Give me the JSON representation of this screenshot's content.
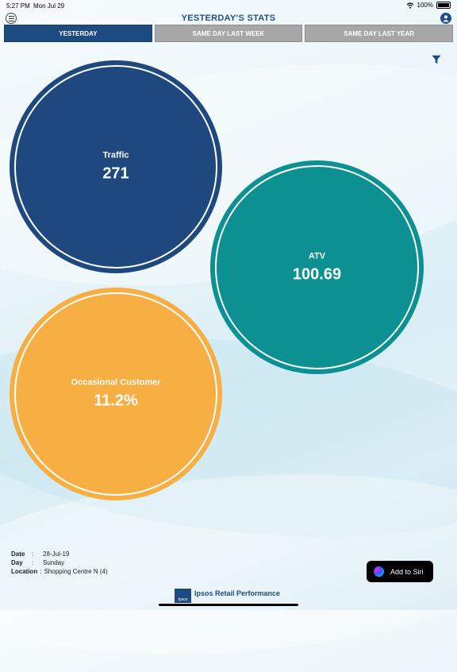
{
  "status_bar": {
    "time": "5:27 PM",
    "date": "Mon Jul 29",
    "battery": "100%"
  },
  "header": {
    "title": "YESTERDAY'S STATS"
  },
  "tabs": [
    {
      "label": "YESTERDAY",
      "active": true
    },
    {
      "label": "SAME DAY LAST WEEK",
      "active": false
    },
    {
      "label": "SAME DAY LAST YEAR",
      "active": false
    }
  ],
  "metrics": [
    {
      "label": "Traffic",
      "value": "271",
      "color": "#1f497e"
    },
    {
      "label": "ATV",
      "value": "100.69",
      "color": "#0d9091"
    },
    {
      "label": "Occasional Customer",
      "value": "11.2%",
      "color": "#f7ae42"
    }
  ],
  "info": {
    "date_key": "Date",
    "date_value": "28-Jul-19",
    "day_key": "Day",
    "day_value": "Sunday",
    "location_key": "Location",
    "location_value": "Shopping Centre N (4)",
    "separator": ":"
  },
  "siri": {
    "label": "Add to Siri"
  },
  "footer": {
    "logo_text": "Ipsos",
    "brand": "Ipsos Retail Performance"
  },
  "colors": {
    "accent": "#1e4a82",
    "tab_inactive": "#a7a7a7"
  },
  "icons": [
    "menu-icon",
    "user-icon",
    "filter-icon",
    "wifi-icon",
    "battery-icon",
    "siri-icon"
  ]
}
